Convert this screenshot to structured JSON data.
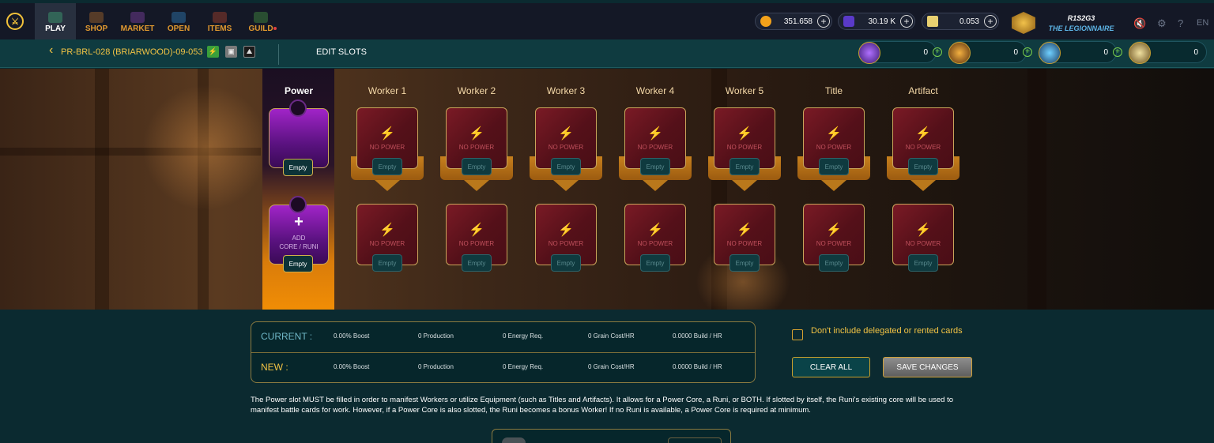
{
  "nav": {
    "logo_glyph": "⚔",
    "items": [
      {
        "label": "PLAY",
        "color": "#3a8f6b"
      },
      {
        "label": "SHOP",
        "color": "#8a5a2a"
      },
      {
        "label": "MARKET",
        "color": "#6a3a8a"
      },
      {
        "label": "OPEN",
        "color": "#2a6a9a"
      },
      {
        "label": "ITEMS",
        "color": "#8a3a2a"
      },
      {
        "label": "GUILD",
        "color": "#3a7a3a"
      }
    ]
  },
  "resources": {
    "dec": "351.658",
    "sps": "30.19 K",
    "voucher": "0.053",
    "plus_glyph": "+"
  },
  "user": {
    "name": "R1S2G3",
    "title": "THE LEGIONNAIRE"
  },
  "top_icons": {
    "mute": "🔇",
    "settings": "⚙",
    "help": "?",
    "lang": "EN"
  },
  "subbar": {
    "back_glyph": "‹",
    "plot_name": "PR-BRL-028 (BRIARWOOD)-09-053",
    "badge1": "⚡",
    "badge2": "▣",
    "badge3": "⛰",
    "edit_slots": "EDIT SLOTS",
    "stats": [
      "0",
      "0",
      "0",
      "0"
    ],
    "stat_plus": "+"
  },
  "slots": {
    "power_label": "Power",
    "labels": [
      "Worker 1",
      "Worker 2",
      "Worker 3",
      "Worker 4",
      "Worker 5",
      "Title",
      "Artifact"
    ],
    "no_power": "NO POWER",
    "empty": "Empty",
    "bolt": "⚡",
    "add_plus": "+",
    "add_line1": "ADD",
    "add_line2": "CORE / RUNI"
  },
  "summary": {
    "current_label": "CURRENT :",
    "new_label": "NEW :",
    "current": [
      "0.00% Boost",
      "0 Production",
      "0 Energy Req.",
      "0 Grain Cost/HR",
      "0.0000 Build / HR"
    ],
    "new": [
      "0.00% Boost",
      "0 Production",
      "0 Energy Req.",
      "0 Grain Cost/HR",
      "0.0000 Build / HR"
    ]
  },
  "options": {
    "exclude_label": "Don't include delegated or rented cards",
    "clear_all": "CLEAR ALL",
    "save_changes": "SAVE CHANGES"
  },
  "info_text": "The Power slot MUST be filled in order to manifest Workers or utilize Equipment (such as Titles and Artifacts). It allows for a Power Core, a Runi, or BOTH. If slotted by itself, the Runi's existing core will be used to manifest battle cards for work. However, if a Power Core is also slotted, the Runi becomes a bonus Worker! If no Runi is available, a Power Core is required at minimum.",
  "colors": {
    "accent_gold": "#f2c344",
    "teal_bg": "#0b2a30",
    "power_orange": "#f18d05"
  }
}
